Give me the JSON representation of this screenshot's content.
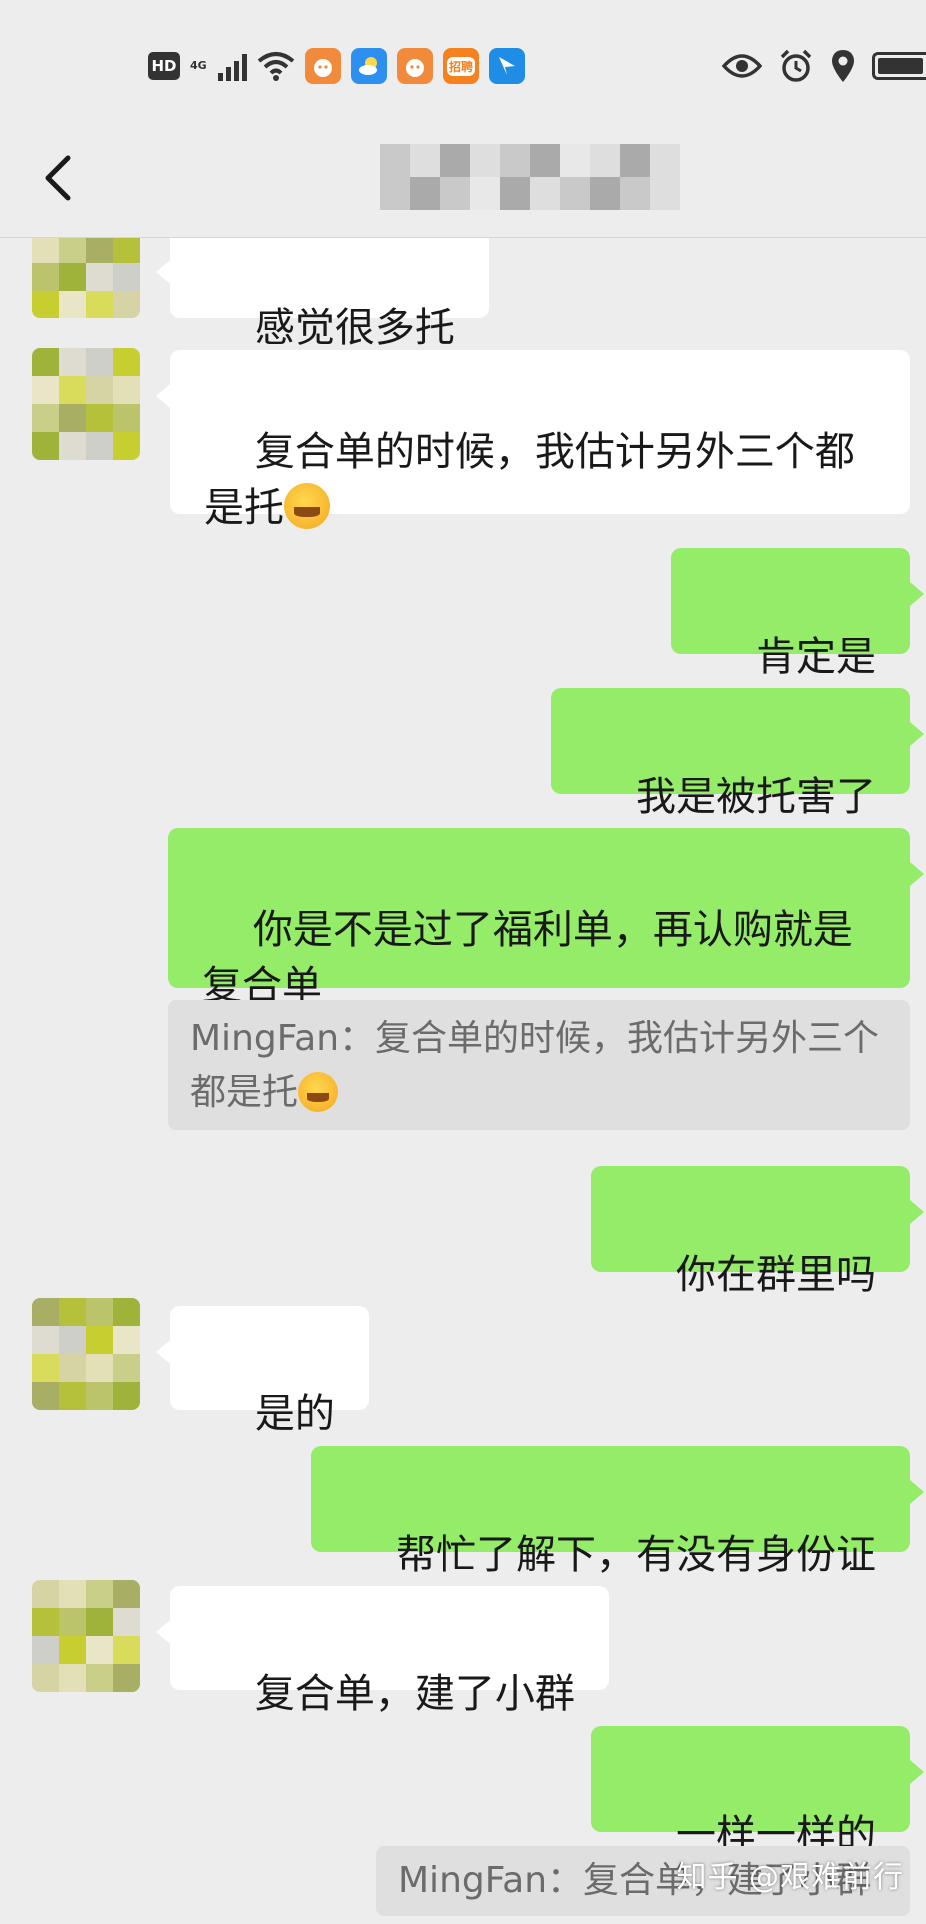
{
  "status_bar": {
    "hd": "HD",
    "network": "4G",
    "icons": [
      "signal-icon",
      "wifi-icon",
      "app-icon-1",
      "weather-icon",
      "app-icon-2",
      "recruit-app-icon",
      "send-icon",
      "eye-icon",
      "alarm-icon",
      "location-icon",
      "battery-icon"
    ],
    "recruit_badge": "招聘"
  },
  "header": {
    "title": "",
    "back_icon": "chevron-left-icon"
  },
  "messages": [
    {
      "side": "left",
      "text": "感觉很多托"
    },
    {
      "side": "left",
      "text": "复合单的时候，我估计另外三个都是托",
      "emoji": "laughing-crying-emoji"
    },
    {
      "side": "right",
      "text": "肯定是"
    },
    {
      "side": "right",
      "text": "我是被托害了"
    },
    {
      "side": "right",
      "text": "你是不是过了福利单，再认购就是复合单"
    },
    {
      "side": "quote",
      "text": "MingFan：复合单的时候，我估计另外三个都是托",
      "emoji": "laughing-crying-emoji"
    },
    {
      "side": "right",
      "text": "你在群里吗"
    },
    {
      "side": "left",
      "text": "是的"
    },
    {
      "side": "right",
      "text": "帮忙了解下，有没有身份证"
    },
    {
      "side": "left",
      "text": "复合单，建了小群"
    },
    {
      "side": "right",
      "text": "一样一样的"
    },
    {
      "side": "quote",
      "text": "MingFan：复合单，建了小群"
    }
  ],
  "watermark": "知乎 @艰难前行",
  "colors": {
    "background": "#ededed",
    "self_bubble": "#95ec69",
    "other_bubble": "#ffffff",
    "quote": "#dfdfdf"
  }
}
